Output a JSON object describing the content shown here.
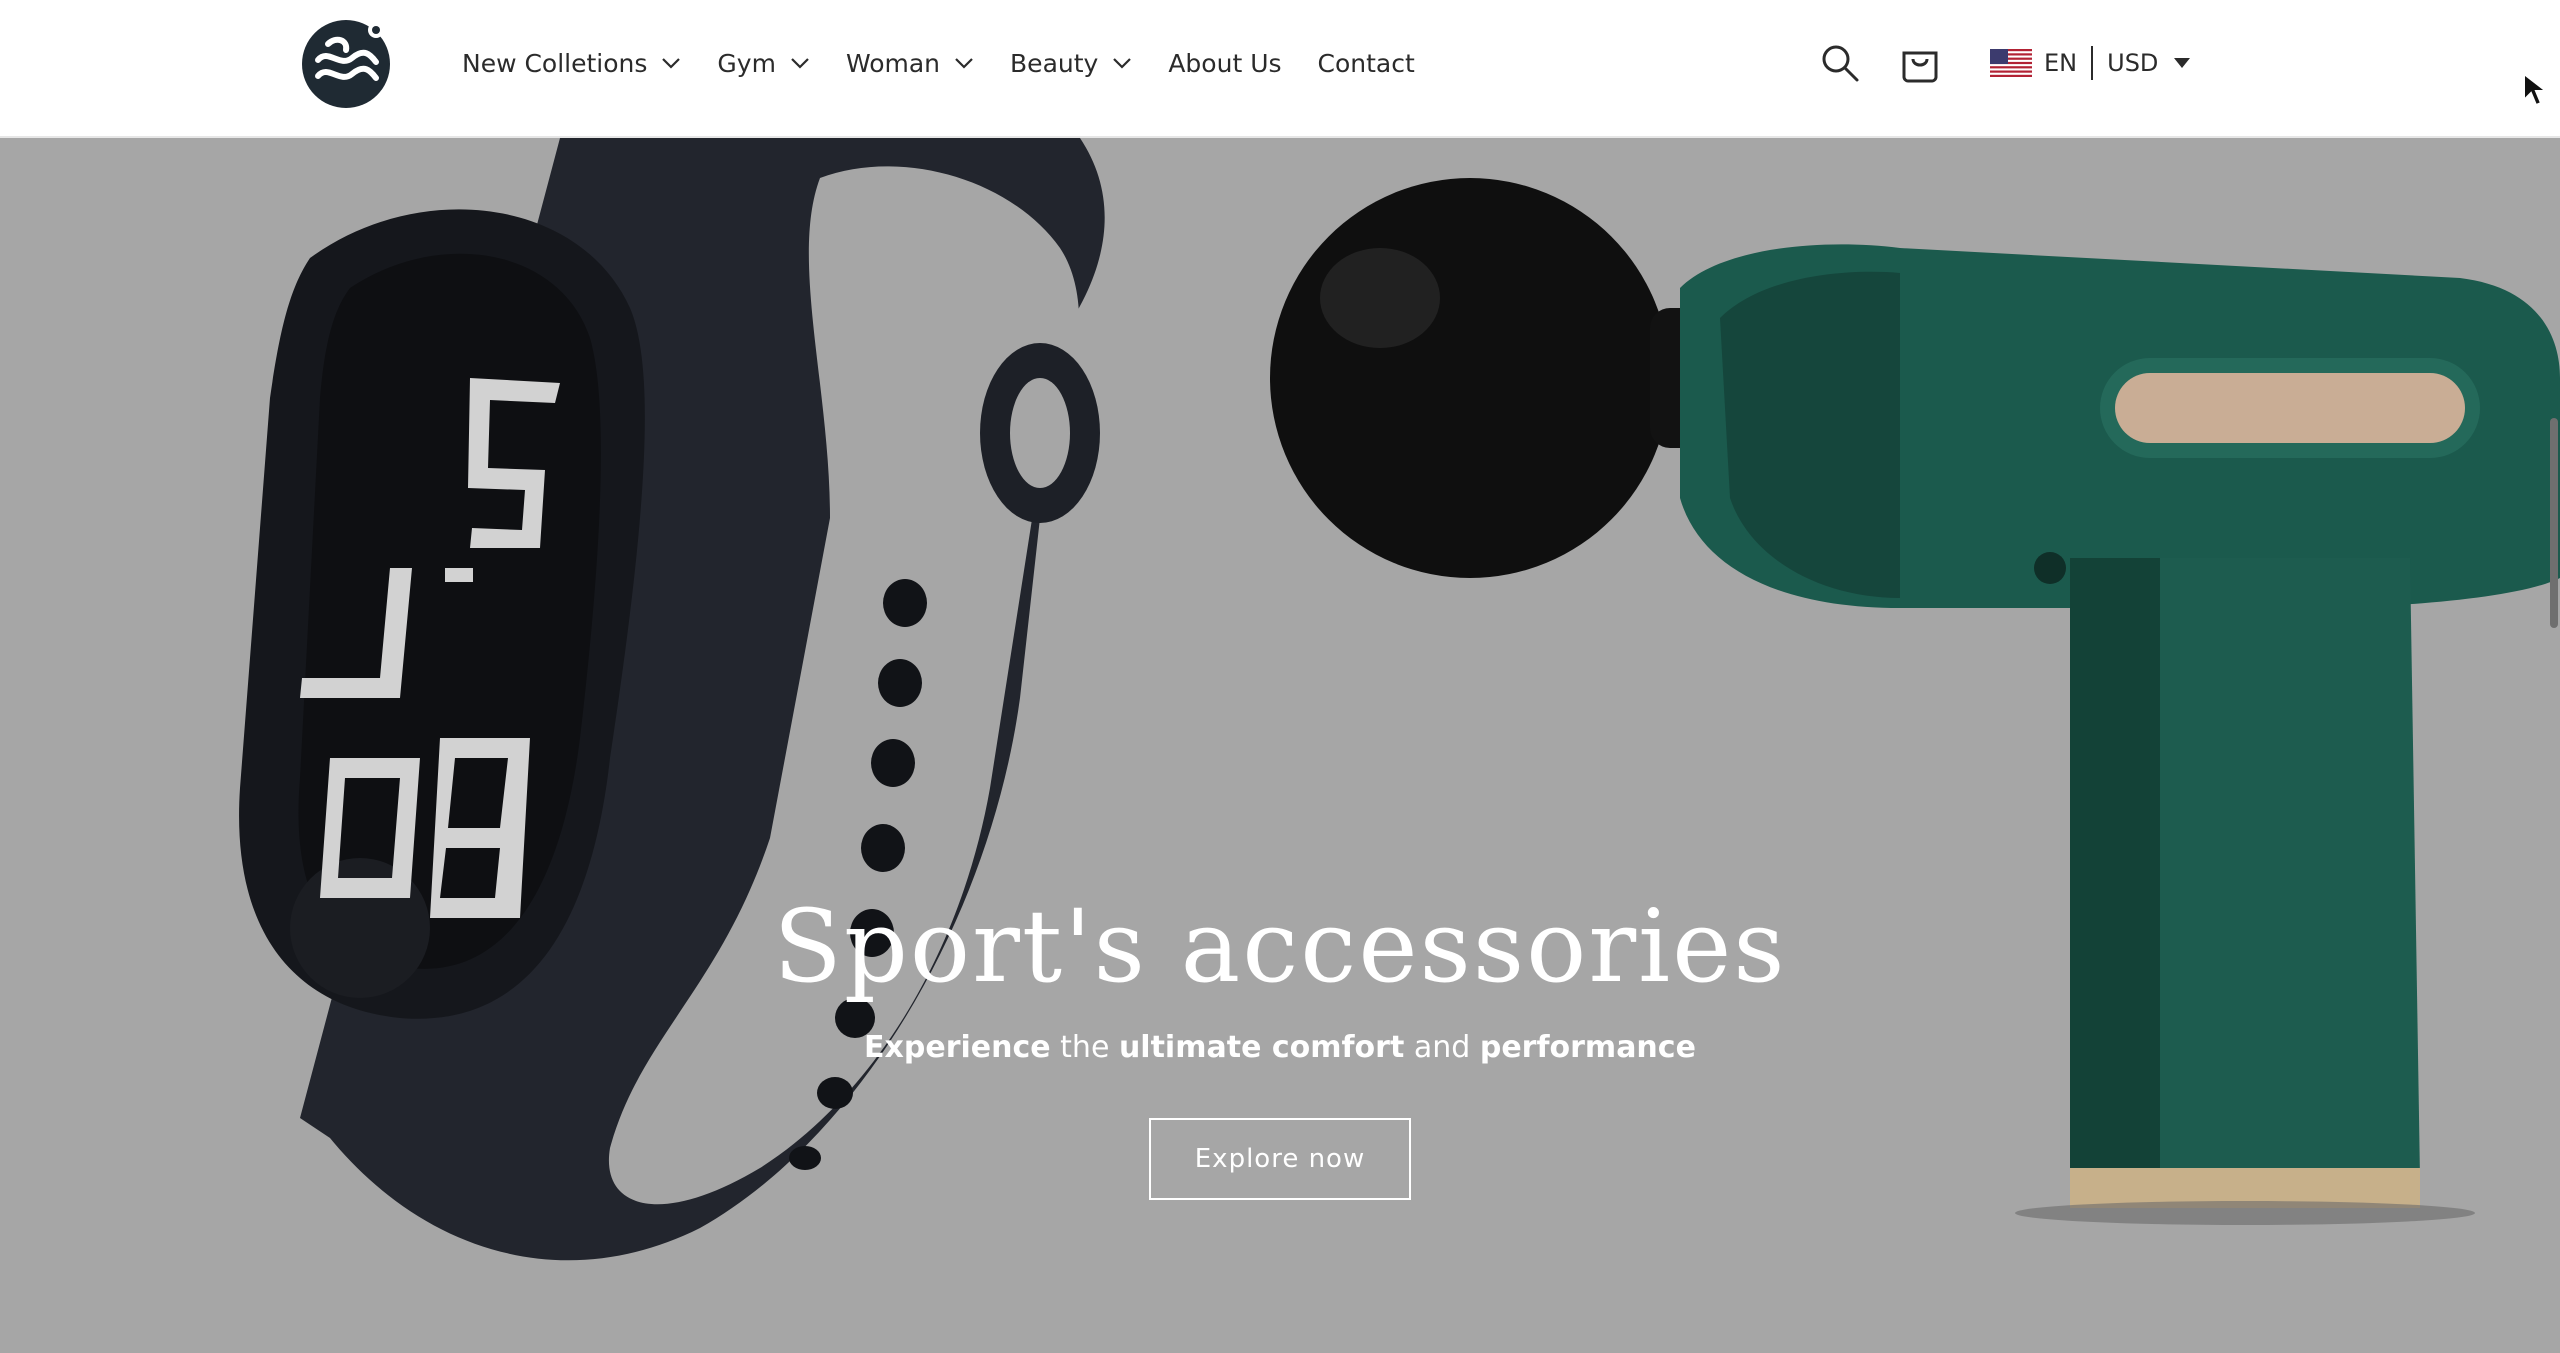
{
  "header": {
    "logo_name": "wave-logo",
    "nav": [
      {
        "label": "New Colletions",
        "has_dropdown": true
      },
      {
        "label": "Gym",
        "has_dropdown": true
      },
      {
        "label": "Woman",
        "has_dropdown": true
      },
      {
        "label": "Beauty",
        "has_dropdown": true
      },
      {
        "label": "About Us",
        "has_dropdown": false
      },
      {
        "label": "Contact",
        "has_dropdown": false
      }
    ],
    "locale": {
      "language": "EN",
      "currency": "USD",
      "flag_icon": "us-flag-icon"
    }
  },
  "hero": {
    "title": "Sport's accessories",
    "subtitle": {
      "w1": "Experience",
      "w2": "the",
      "w3": "ultimate comfort",
      "w4": "and",
      "w5": "performance"
    },
    "cta_label": "Explore now",
    "watch_display_digits": "5:38"
  },
  "colors": {
    "header_bg": "#ffffff",
    "hero_bg": "#a6a6a6",
    "text_dark": "#2b2b2b",
    "text_light": "#ffffff",
    "massager_green": "#1d5a4e"
  }
}
